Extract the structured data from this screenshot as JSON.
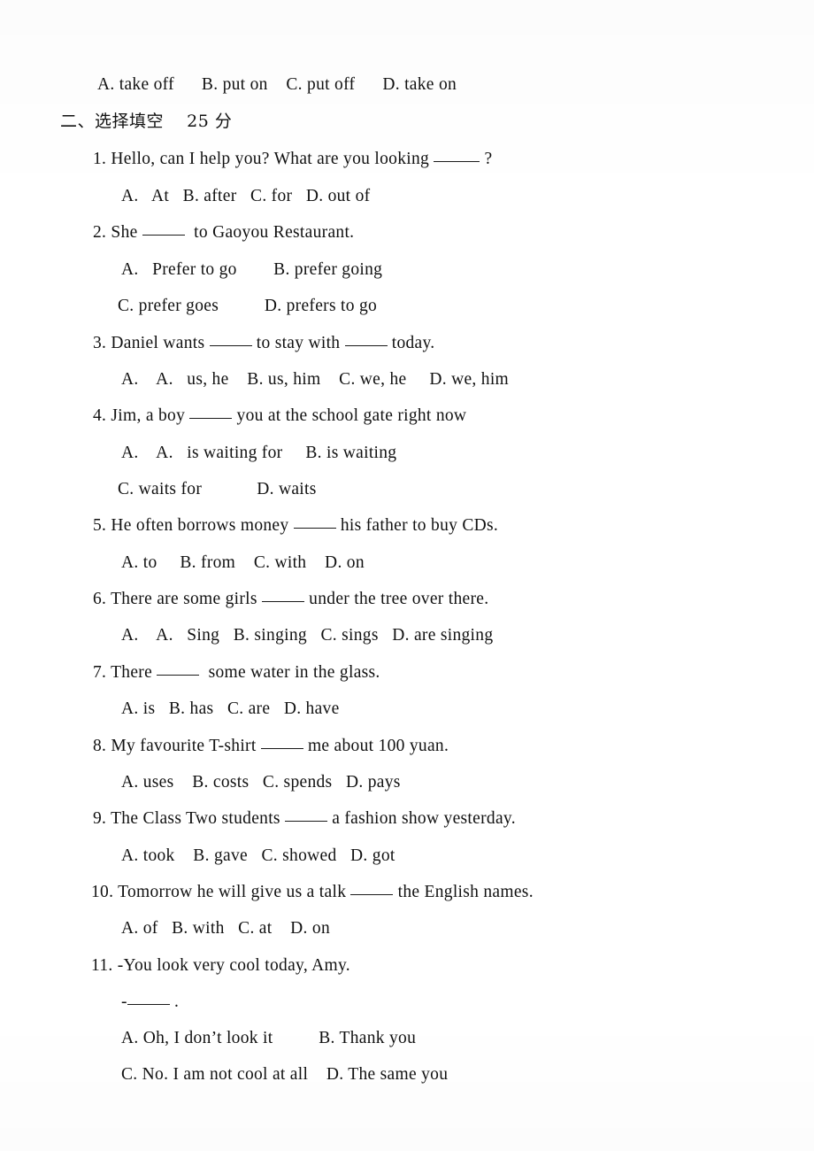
{
  "document": {
    "type": "exam-paper-scan",
    "language": "en-zh",
    "page_background": "#ffffff",
    "text_color": "#111111"
  },
  "top_options_line": {
    "text": "A. take off      B. put on    C. put off      D. take on"
  },
  "section_heading": {
    "label": "二、选择填空",
    "points": "25 分",
    "full": "二、选择填空    25 分"
  },
  "questions": [
    {
      "number": "1.",
      "stem_before": "Hello, can I help you? What are you looking",
      "stem_after": "?",
      "blanks": 1,
      "option_lines": [
        {
          "text": "A.   At   B. after   C. for   D. out of",
          "indent": "opt"
        }
      ]
    },
    {
      "number": "2.",
      "stem_before": "She",
      "stem_after": "to Gaoyou Restaurant.",
      "blanks": 1,
      "option_lines": [
        {
          "text": "A.   Prefer to go        B. prefer going",
          "indent": "opt"
        },
        {
          "text": "C. prefer goes          D. prefers to go",
          "indent": "opt2"
        }
      ]
    },
    {
      "number": "3.",
      "stem_before": "Daniel wants",
      "stem_middle": "to stay with",
      "stem_after": "today.",
      "blanks": 2,
      "option_lines": [
        {
          "text": "A.    A.   us, he    B. us, him    C. we, he     D. we, him",
          "indent": "opt"
        }
      ]
    },
    {
      "number": "4.",
      "stem_before": "Jim, a boy",
      "stem_after": "you at the school gate right now",
      "blanks": 1,
      "option_lines": [
        {
          "text": "A.    A.   is waiting for     B. is waiting",
          "indent": "opt"
        },
        {
          "text": "C. waits for            D. waits",
          "indent": "opt2"
        }
      ]
    },
    {
      "number": "5.",
      "stem_before": "He often borrows money",
      "stem_after": "his father to buy CDs.",
      "blanks": 1,
      "option_lines": [
        {
          "text": "A. to     B. from    C. with    D. on",
          "indent": "opt"
        }
      ]
    },
    {
      "number": "6.",
      "stem_before": "There are some girls",
      "stem_after": "under the tree over there.",
      "blanks": 1,
      "option_lines": [
        {
          "text": "A.    A.   Sing   B. singing   C. sings   D. are singing",
          "indent": "opt"
        }
      ]
    },
    {
      "number": "7.",
      "stem_before": "There",
      "stem_after": "some water in the glass.",
      "blanks": 1,
      "option_lines": [
        {
          "text": "A. is   B. has   C. are   D. have",
          "indent": "opt"
        }
      ]
    },
    {
      "number": "8.",
      "stem_before": "My favourite T-shirt",
      "stem_after": "me about 100 yuan.",
      "blanks": 1,
      "option_lines": [
        {
          "text": "A. uses    B. costs   C. spends   D. pays",
          "indent": "opt"
        }
      ]
    },
    {
      "number": "9.",
      "stem_before": "The Class Two students",
      "stem_after": "a fashion show yesterday.",
      "blanks": 1,
      "option_lines": [
        {
          "text": "A. took    B. gave   C. showed   D. got",
          "indent": "opt"
        }
      ]
    },
    {
      "number": "10.",
      "stem_before": "Tomorrow he will give us a talk",
      "stem_after": "the English names.",
      "blanks": 1,
      "option_lines": [
        {
          "text": "A. of   B. with   C. at    D. on",
          "indent": "opt"
        }
      ]
    },
    {
      "number": "11.",
      "stem_before": "-You look very cool today, Amy.",
      "stem_after": "",
      "blanks": 0,
      "answer_prompt": {
        "dash": "-",
        "trailing": "."
      },
      "option_lines": [
        {
          "text": "A. Oh, I don’t look it          B. Thank you",
          "indent": "opt"
        },
        {
          "text": "C. No. I am not cool at all    D. The same you",
          "indent": "opt"
        }
      ]
    }
  ]
}
